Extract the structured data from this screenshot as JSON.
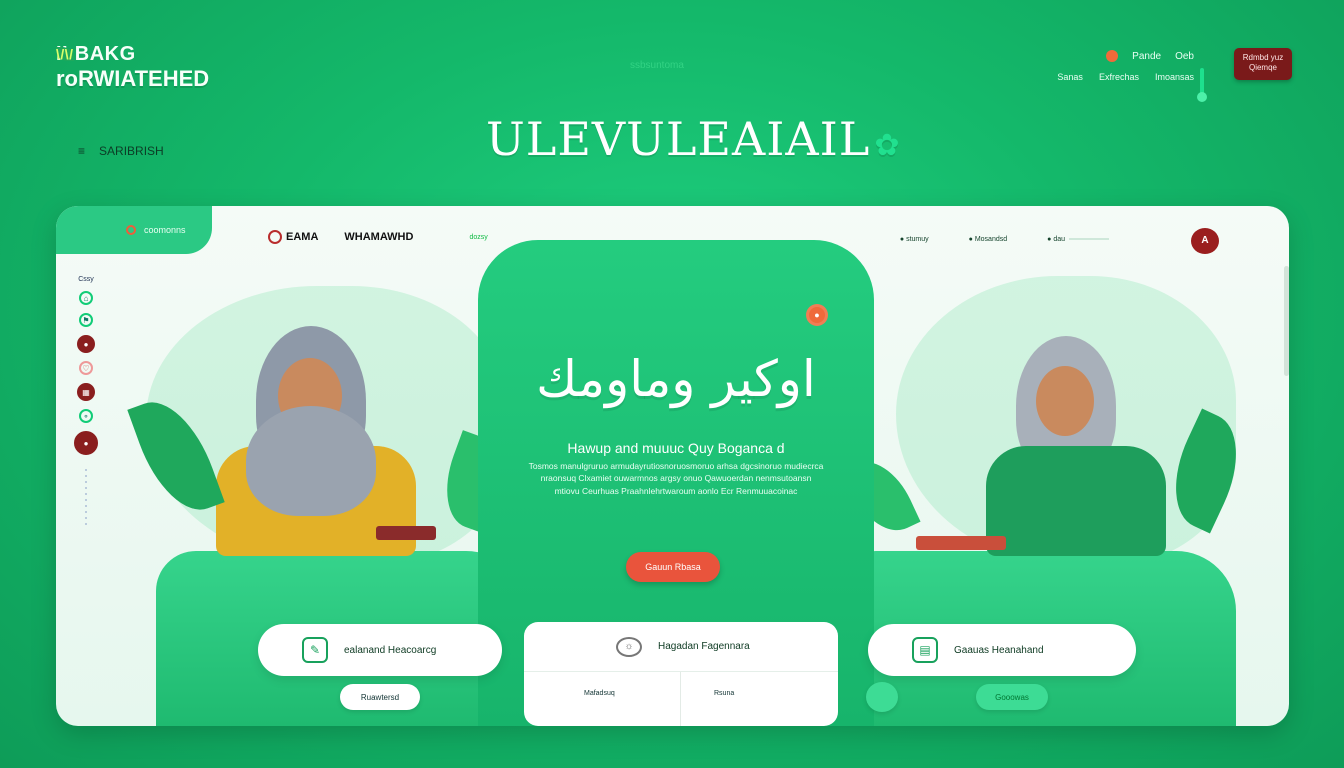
{
  "header": {
    "brand_line1": "ILBAKG",
    "brand_leaf": "\\/\\/",
    "brand_line2": "roRWIATEHED",
    "center_label": "ssbsuntoma",
    "top_right": {
      "item1": "Pande",
      "item2": "Oeb",
      "link1": "Sanas",
      "link2": "Exfrechas",
      "link3": "Imoansas",
      "cta_label": "Rdmbd yuz Qiemqe"
    },
    "lang_label": "SARIBRISH",
    "hero_title": "ULEVULEAIAIL"
  },
  "panel": {
    "tab_label": "coomonns",
    "nav": {
      "logo_text": "EAMA",
      "menu1": "WHAMAWHD",
      "menu2": "dozsy",
      "right1": "stumuy",
      "right2": "Mosandsd",
      "right3": "dau",
      "avatar": "A"
    },
    "sidebar": {
      "label": "Cssy"
    },
    "center": {
      "calligraphy": "اوكير وماومك",
      "subtitle": "Hawup and muuuc Quy Boganca d",
      "paragraph": "Tosmos manulgruruo armudayrutiosnoruosmoruo arhsa dgcsinoruo mudiecrca nraonsuq Clxamiet ouwarmnos argsy onuo Qawuoerdan nenmsutoansn mtiovu Ceurhuas Praahnlehrtwaroum aonlo Ecr Renmuuacoinac",
      "cta_label": "Gauun Rbasa"
    },
    "cards": {
      "left_card": "ealanand Heacoarcg",
      "left_mini": "Ruawtersd",
      "center_card": "Hagadan Fagennara",
      "center_lbl1": "Mafadsuq",
      "center_lbl2": "Rsuna",
      "right_card": "Gaauas Heanahand",
      "right_mini": "Gooowas"
    }
  },
  "colors": {
    "bg_green": "#14b86a",
    "panel_green": "#24cc7f",
    "accent_red": "#9a1e1e",
    "accent_orange": "#ef6a3b"
  }
}
